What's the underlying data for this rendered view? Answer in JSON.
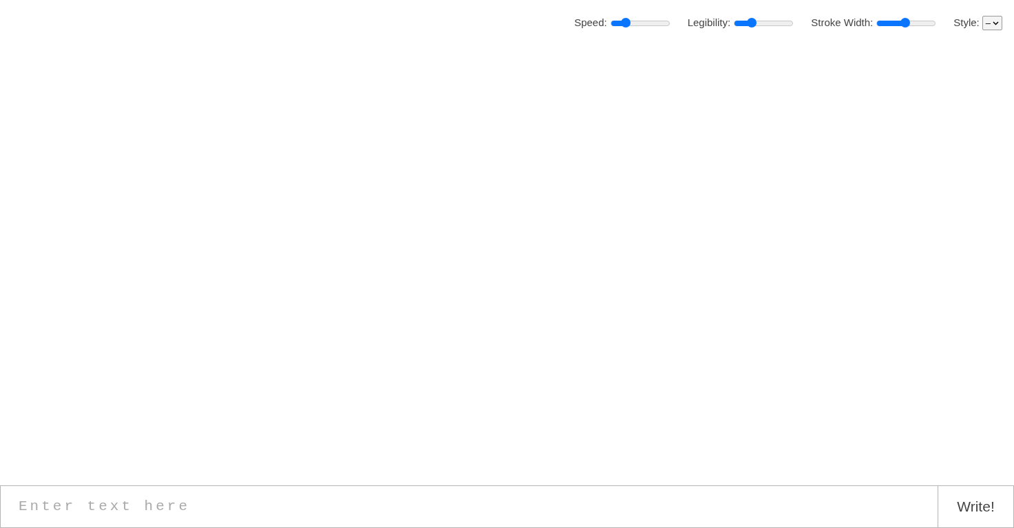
{
  "controls": [
    {
      "label": "Speed:",
      "level": 0.25
    },
    {
      "label": "Legibility:",
      "level": 0.29
    },
    {
      "label": "Stroke Width:",
      "level": 0.48
    }
  ],
  "style": {
    "label": "Style:",
    "value": "–"
  },
  "input": {
    "placeholder": "Enter text here"
  },
  "button": {
    "label": "Write!"
  }
}
